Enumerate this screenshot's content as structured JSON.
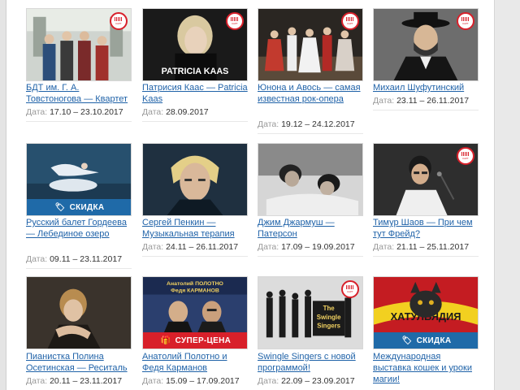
{
  "date_label": "Дата:",
  "badges": {
    "discount": "СКИДКА",
    "super_price": "СУПЕР-ЦЕНА"
  },
  "ticket_icon_text": "КАРТ",
  "events": [
    {
      "title": "БДТ им. Г. А. Товстоногова — Квартет",
      "date": "17.10 – 23.10.2017",
      "badge": null,
      "ticket_icon": true
    },
    {
      "title": "Патрисия Каас — Patricia Kaas",
      "date": "28.09.2017",
      "badge": null,
      "ticket_icon": true,
      "image_text": "PATRICIA KAAS"
    },
    {
      "title": "Юнона и Авось — самая известная рок-опера",
      "date": "19.12 – 24.12.2017",
      "badge": null,
      "ticket_icon": true
    },
    {
      "title": "Михаил Шуфутинский",
      "date": "23.11 – 26.11.2017",
      "badge": null,
      "ticket_icon": true
    },
    {
      "title": "Русский балет Гордеева — Лебединое озеро",
      "date": "09.11 – 23.11.2017",
      "badge": "discount",
      "ticket_icon": false
    },
    {
      "title": "Сергей Пенкин — Музыкальная терапия",
      "date": "24.11 – 26.11.2017",
      "badge": null,
      "ticket_icon": false
    },
    {
      "title": "Джим Джармуш — Патерсон",
      "date": "17.09 – 19.09.2017",
      "badge": null,
      "ticket_icon": false
    },
    {
      "title": "Тимур Шаов — При чем тут Фрейд?",
      "date": "21.11 – 25.11.2017",
      "badge": null,
      "ticket_icon": true
    },
    {
      "title": "Пианистка Полина Осетинская — Реситаль",
      "date": "20.11 – 23.11.2017",
      "badge": null,
      "ticket_icon": false
    },
    {
      "title": "Анатолий Полотно и Федя Карманов",
      "date": "15.09 – 17.09.2017",
      "badge": "super_price",
      "ticket_icon": false,
      "image_text": [
        "Анатолий ПОЛОТНО",
        "Федя КАРМАНОВ"
      ]
    },
    {
      "title": "Swingle Singers с новой программой!",
      "date": "22.09 – 23.09.2017",
      "badge": null,
      "ticket_icon": true,
      "image_text": [
        "The",
        "Swingle",
        "Singers"
      ]
    },
    {
      "title": "Международная выставка кошек и уроки магии!",
      "date": "",
      "badge": "discount",
      "ticket_icon": false,
      "image_text": "ХАТУЛЬЯДИЯ"
    }
  ],
  "colors": {
    "link": "#1f62a8",
    "discount_badge": "#1f6aa8",
    "super_price_badge": "#d8202a"
  }
}
